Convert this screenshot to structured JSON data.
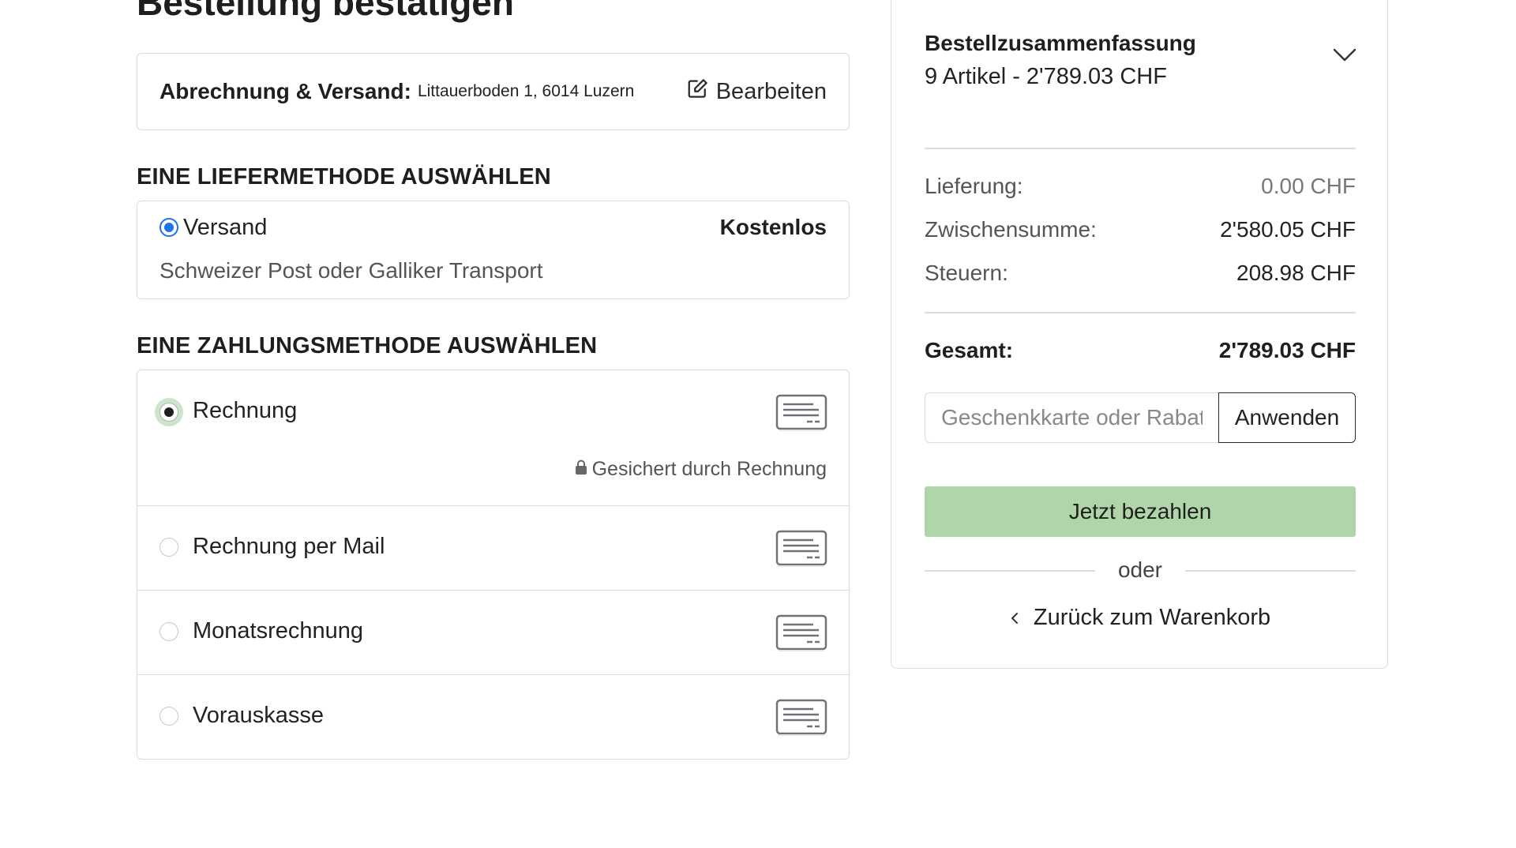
{
  "page": {
    "title": "Bestellung bestätigen"
  },
  "address": {
    "label": "Abrechnung & Versand:",
    "value": "Littauerboden 1, 6014 Luzern",
    "edit_label": "Bearbeiten"
  },
  "shipping": {
    "heading": "EINE LIEFERMETHODE AUSWÄHLEN",
    "option": {
      "name": "Versand",
      "price": "Kostenlos",
      "description": "Schweizer Post oder Galliker Transport",
      "selected": true
    }
  },
  "payment": {
    "heading": "EINE ZAHLUNGSMETHODE AUSWÄHLEN",
    "options": [
      {
        "label": "Rechnung",
        "selected": true,
        "icon": "invoice-card-icon"
      },
      {
        "label": "Rechnung per Mail",
        "selected": false,
        "icon": "invoice-card-icon"
      },
      {
        "label": "Monatsrechnung",
        "selected": false,
        "icon": "invoice-card-icon"
      },
      {
        "label": "Vorauskasse",
        "selected": false,
        "icon": "invoice-card-icon"
      }
    ],
    "secured_text": "Gesichert durch Rechnung"
  },
  "summary": {
    "title": "Bestellzusammenfassung",
    "subtitle": "9 Artikel -  2'789.03 CHF",
    "lines": [
      {
        "label": "Lieferung:",
        "value": "0.00 CHF"
      },
      {
        "label": "Zwischensumme:",
        "value": "2'580.05 CHF"
      },
      {
        "label": "Steuern:",
        "value": "208.98 CHF"
      }
    ],
    "total": {
      "label": "Gesamt:",
      "value": "2'789.03 CHF"
    },
    "coupon": {
      "placeholder": "Geschenkkarte oder Rabattcode",
      "button": "Anwenden"
    },
    "pay_button": "Jetzt bezahlen",
    "or_text": "oder",
    "back_link": "Zurück zum Warenkorb"
  },
  "colors": {
    "accent_blue": "#1a73e8",
    "pay_button_green": "#b1d5aa",
    "border": "#dcdcdc"
  }
}
